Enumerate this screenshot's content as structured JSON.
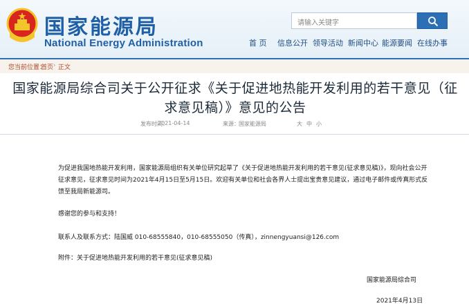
{
  "header": {
    "logo_cn": "国家能源局",
    "logo_en": "National Energy Administration",
    "search_placeholder": "请输入关键字",
    "nav": [
      "首 页",
      "信息公开",
      "领导活动",
      "新闻中心",
      "能源要闻",
      "在线办事"
    ]
  },
  "breadcrumb": {
    "items": [
      "您当前位置：",
      "首页",
      "正文"
    ],
    "separator": "›"
  },
  "article": {
    "title": "国家能源局综合司关于公开征求《关于促进地热能开发利用的若干意见（征求意见稿）》意见的公告",
    "date_label": "发布时间：",
    "date": "2021-04-14",
    "source_label": "来源：",
    "source": "国家能源局",
    "font_sizes": [
      "大",
      "中",
      "小"
    ],
    "paragraphs": [
      "为促进我国地热能开发利用，国家能源局组织有关单位研究起草了《关于促进地热能开发利用的若干意见(征求意见稿)》，现向社会公开征求意见，征求意见时间为2021年4月15日至5月15日。欢迎有关单位和社会各界人士提出宝贵意见建议，通过电子邮件或传真形式反馈至我局新能源司。",
      "感谢您的参与和支持！",
      "联系人及联系方式：陆国威 010-68555840，010-68555050（传真），zinnengyuansi@126.com",
      "附件：关于促进地热能开发利用的若干意见(征求意见稿)"
    ],
    "signature_org": "国家能源局综合司",
    "signature_date": "2021年4月13日"
  },
  "colors": {
    "brand_blue": "#1f5fa6",
    "breadcrumb_red": "#b04a2a",
    "emblem_red": "#d8261e",
    "emblem_gold": "#f2c52b"
  },
  "icons": [
    "national-emblem-icon",
    "search-icon"
  ]
}
